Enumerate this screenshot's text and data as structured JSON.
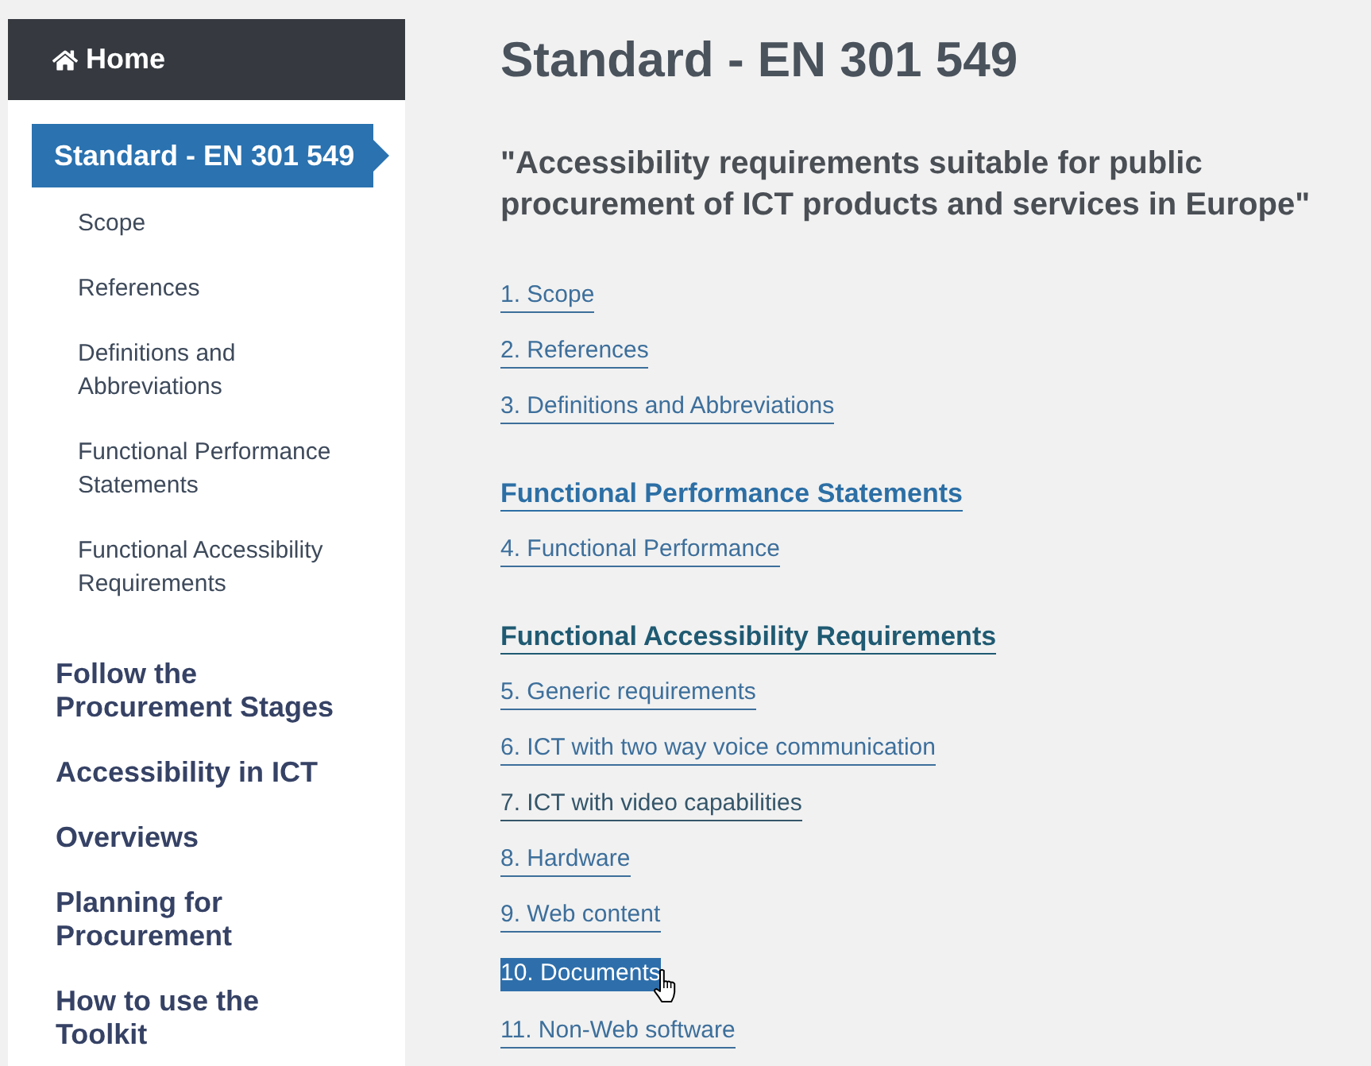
{
  "sidebar": {
    "home": {
      "label": "Home"
    },
    "nav": [
      {
        "label": "Standard - EN 301 549",
        "selected": true,
        "children": [
          {
            "label": "Scope",
            "selected": false
          },
          {
            "label": "References",
            "selected": false
          },
          {
            "label": "Definitions and Abbreviations",
            "selected": false
          },
          {
            "label": "Functional Performance Statements",
            "selected": false
          },
          {
            "label": "Functional Accessibility Requirements",
            "selected": false
          }
        ]
      },
      {
        "label": "Follow the Procurement Stages",
        "selected": false
      },
      {
        "label": "Accessibility in ICT",
        "selected": false
      },
      {
        "label": "Overviews",
        "selected": false
      },
      {
        "label": "Planning for Procurement",
        "selected": false
      },
      {
        "label": "How to use the Toolkit",
        "selected": false
      }
    ]
  },
  "main": {
    "title": "Standard - EN 301 549",
    "subtitle": "\"Accessibility requirements suitable for public procurement of ICT products and services in Europe\"",
    "contents": [
      {
        "kind": "link",
        "label": "1. Scope",
        "visited": false,
        "highlighted": false
      },
      {
        "kind": "link",
        "label": "2. References",
        "visited": false,
        "highlighted": false
      },
      {
        "kind": "link",
        "label": "3. Definitions and Abbreviations",
        "visited": false,
        "highlighted": false
      },
      {
        "kind": "heading",
        "label": "Functional Performance Statements",
        "visited": false,
        "highlighted": false
      },
      {
        "kind": "link",
        "label": "4. Functional Performance",
        "visited": false,
        "highlighted": false
      },
      {
        "kind": "heading",
        "label": "Functional Accessibility Requirements",
        "visited": true,
        "highlighted": false
      },
      {
        "kind": "link",
        "label": "5. Generic requirements",
        "visited": false,
        "highlighted": false
      },
      {
        "kind": "link",
        "label": "6. ICT with two way voice communication",
        "visited": false,
        "highlighted": false
      },
      {
        "kind": "link",
        "label": "7. ICT with video capabilities",
        "visited": true,
        "highlighted": false
      },
      {
        "kind": "link",
        "label": "8. Hardware",
        "visited": false,
        "highlighted": false
      },
      {
        "kind": "link",
        "label": "9. Web content",
        "visited": false,
        "highlighted": false
      },
      {
        "kind": "link",
        "label": "10. Documents",
        "visited": false,
        "highlighted": true
      },
      {
        "kind": "link",
        "label": "11. Non-Web software",
        "visited": false,
        "highlighted": false
      }
    ]
  }
}
